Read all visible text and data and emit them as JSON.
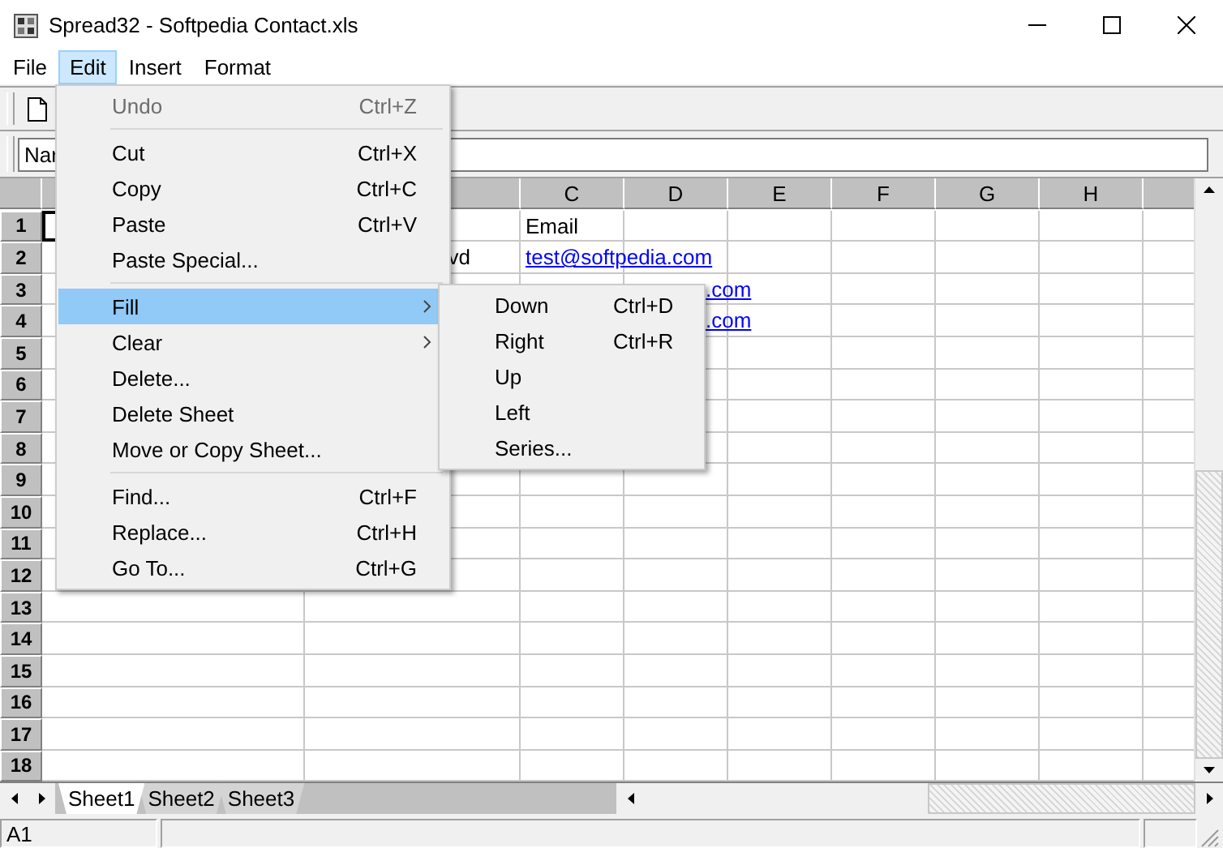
{
  "window": {
    "title": "Spread32 - Softpedia Contact.xls"
  },
  "menubar": [
    {
      "label": "File",
      "selected": false
    },
    {
      "label": "Edit",
      "selected": true
    },
    {
      "label": "Insert",
      "selected": false
    },
    {
      "label": "Format",
      "selected": false
    }
  ],
  "name_box": {
    "value": "Nar"
  },
  "sheet": {
    "columns": [
      {},
      {},
      {
        "label": "C"
      },
      {
        "label": "D"
      },
      {
        "label": "E"
      },
      {
        "label": "F"
      },
      {
        "label": "G"
      },
      {
        "label": "H"
      },
      {}
    ],
    "rows": [
      {
        "number": "1",
        "cells": {
          "a": {
            "selected": true
          },
          "c": {
            "text": "Email",
            "kind": "text"
          }
        }
      },
      {
        "number": "2",
        "cells": {
          "b": {
            "text": "vd",
            "kind": "text"
          },
          "c": {
            "text": "test@softpedia.com",
            "kind": "link"
          }
        }
      },
      {
        "number": "3",
        "cells": {
          "c": {
            "text": ".com",
            "kind": "link"
          }
        }
      },
      {
        "number": "4",
        "cells": {
          "c": {
            "text": ".com",
            "kind": "link"
          }
        }
      },
      {
        "number": "5"
      },
      {
        "number": "6"
      },
      {
        "number": "7"
      },
      {
        "number": "8"
      },
      {
        "number": "9"
      },
      {
        "number": "10"
      },
      {
        "number": "11"
      },
      {
        "number": "12"
      },
      {
        "number": "13"
      },
      {
        "number": "14"
      },
      {
        "number": "15"
      },
      {
        "number": "16"
      },
      {
        "number": "17"
      },
      {
        "number": "18"
      }
    ]
  },
  "sheet_tabs": [
    {
      "label": "Sheet1",
      "selected": true
    },
    {
      "label": "Sheet2",
      "selected": false
    },
    {
      "label": "Sheet3",
      "selected": false
    }
  ],
  "status_bar": {
    "cell": "A1"
  },
  "edit_menu": {
    "items": [
      {
        "kind": "item",
        "label": "Undo",
        "shortcut": "Ctrl+Z",
        "disabled": true,
        "submenu": false,
        "selected": false
      },
      {
        "kind": "separator"
      },
      {
        "kind": "item",
        "label": "Cut",
        "shortcut": "Ctrl+X",
        "disabled": false,
        "submenu": false,
        "selected": false
      },
      {
        "kind": "item",
        "label": "Copy",
        "shortcut": "Ctrl+C",
        "disabled": false,
        "submenu": false,
        "selected": false
      },
      {
        "kind": "item",
        "label": "Paste",
        "shortcut": "Ctrl+V",
        "disabled": false,
        "submenu": false,
        "selected": false
      },
      {
        "kind": "item",
        "label": "Paste Special...",
        "disabled": false,
        "submenu": false,
        "selected": false
      },
      {
        "kind": "separator"
      },
      {
        "kind": "item",
        "label": "Fill",
        "disabled": false,
        "submenu": true,
        "selected": true
      },
      {
        "kind": "item",
        "label": "Clear",
        "disabled": false,
        "submenu": true,
        "selected": false
      },
      {
        "kind": "item",
        "label": "Delete...",
        "disabled": false,
        "submenu": false,
        "selected": false
      },
      {
        "kind": "item",
        "label": "Delete Sheet",
        "disabled": false,
        "submenu": false,
        "selected": false
      },
      {
        "kind": "item",
        "label": "Move or Copy Sheet...",
        "disabled": false,
        "submenu": false,
        "selected": false
      },
      {
        "kind": "separator"
      },
      {
        "kind": "item",
        "label": "Find...",
        "shortcut": "Ctrl+F",
        "disabled": false,
        "submenu": false,
        "selected": false
      },
      {
        "kind": "item",
        "label": "Replace...",
        "shortcut": "Ctrl+H",
        "disabled": false,
        "submenu": false,
        "selected": false
      },
      {
        "kind": "item",
        "label": "Go To...",
        "shortcut": "Ctrl+G",
        "disabled": false,
        "submenu": false,
        "selected": false
      }
    ]
  },
  "fill_menu": {
    "items": [
      {
        "kind": "item",
        "label": "Down",
        "shortcut": "Ctrl+D",
        "disabled": false,
        "submenu": false,
        "selected": false
      },
      {
        "kind": "item",
        "label": "Right",
        "shortcut": "Ctrl+R",
        "disabled": false,
        "submenu": false,
        "selected": false
      },
      {
        "kind": "item",
        "label": "Up",
        "disabled": false,
        "submenu": false,
        "selected": false
      },
      {
        "kind": "item",
        "label": "Left",
        "disabled": false,
        "submenu": false,
        "selected": false
      },
      {
        "kind": "item",
        "label": "Series...",
        "disabled": false,
        "submenu": false,
        "selected": false
      }
    ]
  }
}
